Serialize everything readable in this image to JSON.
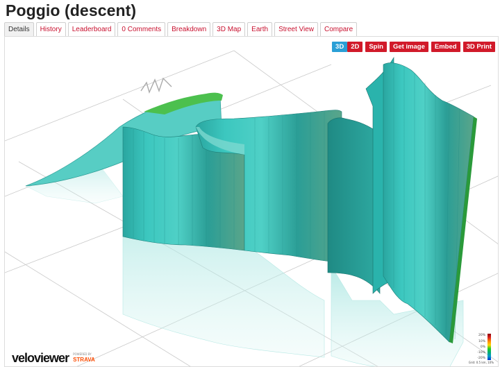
{
  "page": {
    "title": "Poggio (descent)"
  },
  "tabs": [
    {
      "label": "Details",
      "active": true
    },
    {
      "label": "History"
    },
    {
      "label": "Leaderboard"
    },
    {
      "label": "0 Comments"
    },
    {
      "label": "Breakdown"
    },
    {
      "label": "3D Map"
    },
    {
      "label": "Earth"
    },
    {
      "label": "Street View"
    },
    {
      "label": "Compare"
    }
  ],
  "toolbar": {
    "mode_3d": "3D",
    "mode_2d": "2D",
    "spin": "Spin",
    "get_image": "Get image",
    "embed": "Embed",
    "print_3d": "3D Print",
    "selected_mode": "3D"
  },
  "logo": {
    "velo": "velo",
    "viewer": "viewer",
    "powered_by": "POWERED BY",
    "strava": "STRAVA"
  },
  "legend": {
    "labels": [
      "20%",
      "10%",
      "0%",
      "-10%",
      "-20%"
    ],
    "footer": "Grid: 0.5 km, 10%"
  },
  "colors": {
    "accent": "#d11a2a",
    "selected": "#2a9fd6",
    "ribbon_main": "#2fb8b0",
    "ribbon_dark": "#1e8c86",
    "ribbon_green": "#3bb34a",
    "strava": "#fc4c02"
  },
  "icons": {
    "compass": "north-arrow-icon"
  }
}
